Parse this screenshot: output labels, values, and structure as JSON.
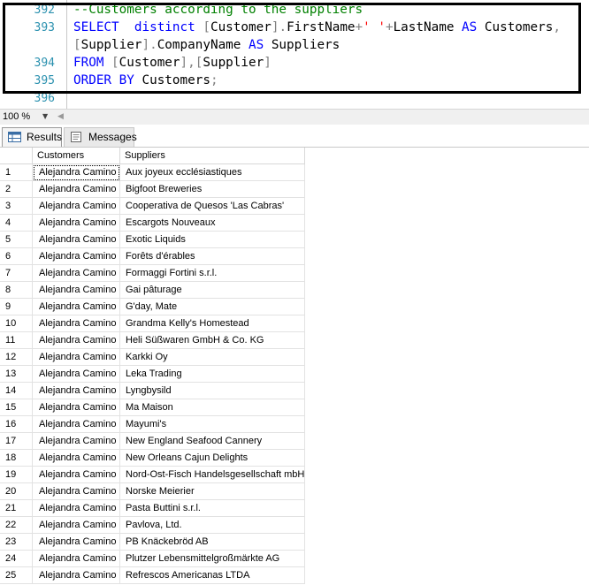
{
  "editor": {
    "lines": [
      {
        "num": "392",
        "text": "--Customers according to the suppliers"
      },
      {
        "num": "393",
        "text": "SELECT  distinct [Customer].FirstName+' '+LastName AS Customers,"
      },
      {
        "num": "",
        "text": "[Supplier].CompanyName AS Suppliers"
      },
      {
        "num": "394",
        "text": "FROM [Customer],[Supplier]"
      },
      {
        "num": "395",
        "text": "ORDER BY Customers;"
      },
      {
        "num": "396",
        "text": ""
      }
    ]
  },
  "zoom": {
    "value": "100 %"
  },
  "tabs": {
    "results": "Results",
    "messages": "Messages"
  },
  "grid": {
    "columns": [
      "Customers",
      "Suppliers"
    ],
    "rows": [
      {
        "n": "1",
        "customer": "Alejandra Camino",
        "supplier": "Aux joyeux ecclésiastiques"
      },
      {
        "n": "2",
        "customer": "Alejandra Camino",
        "supplier": "Bigfoot Breweries"
      },
      {
        "n": "3",
        "customer": "Alejandra Camino",
        "supplier": "Cooperativa de Quesos 'Las Cabras'"
      },
      {
        "n": "4",
        "customer": "Alejandra Camino",
        "supplier": "Escargots Nouveaux"
      },
      {
        "n": "5",
        "customer": "Alejandra Camino",
        "supplier": "Exotic Liquids"
      },
      {
        "n": "6",
        "customer": "Alejandra Camino",
        "supplier": "Forêts d'érables"
      },
      {
        "n": "7",
        "customer": "Alejandra Camino",
        "supplier": "Formaggi Fortini s.r.l."
      },
      {
        "n": "8",
        "customer": "Alejandra Camino",
        "supplier": "Gai pâturage"
      },
      {
        "n": "9",
        "customer": "Alejandra Camino",
        "supplier": "G'day, Mate"
      },
      {
        "n": "10",
        "customer": "Alejandra Camino",
        "supplier": "Grandma Kelly's Homestead"
      },
      {
        "n": "11",
        "customer": "Alejandra Camino",
        "supplier": "Heli Süßwaren GmbH & Co. KG"
      },
      {
        "n": "12",
        "customer": "Alejandra Camino",
        "supplier": "Karkki Oy"
      },
      {
        "n": "13",
        "customer": "Alejandra Camino",
        "supplier": "Leka Trading"
      },
      {
        "n": "14",
        "customer": "Alejandra Camino",
        "supplier": "Lyngbysild"
      },
      {
        "n": "15",
        "customer": "Alejandra Camino",
        "supplier": "Ma Maison"
      },
      {
        "n": "16",
        "customer": "Alejandra Camino",
        "supplier": "Mayumi's"
      },
      {
        "n": "17",
        "customer": "Alejandra Camino",
        "supplier": "New England Seafood Cannery"
      },
      {
        "n": "18",
        "customer": "Alejandra Camino",
        "supplier": "New Orleans Cajun Delights"
      },
      {
        "n": "19",
        "customer": "Alejandra Camino",
        "supplier": "Nord-Ost-Fisch Handelsgesellschaft mbH"
      },
      {
        "n": "20",
        "customer": "Alejandra Camino",
        "supplier": "Norske Meierier"
      },
      {
        "n": "21",
        "customer": "Alejandra Camino",
        "supplier": "Pasta Buttini s.r.l."
      },
      {
        "n": "22",
        "customer": "Alejandra Camino",
        "supplier": "Pavlova, Ltd."
      },
      {
        "n": "23",
        "customer": "Alejandra Camino",
        "supplier": "PB Knäckebröd AB"
      },
      {
        "n": "24",
        "customer": "Alejandra Camino",
        "supplier": "Plutzer Lebensmittelgroßmärkte AG"
      },
      {
        "n": "25",
        "customer": "Alejandra Camino",
        "supplier": "Refrescos Americanas LTDA"
      }
    ]
  }
}
